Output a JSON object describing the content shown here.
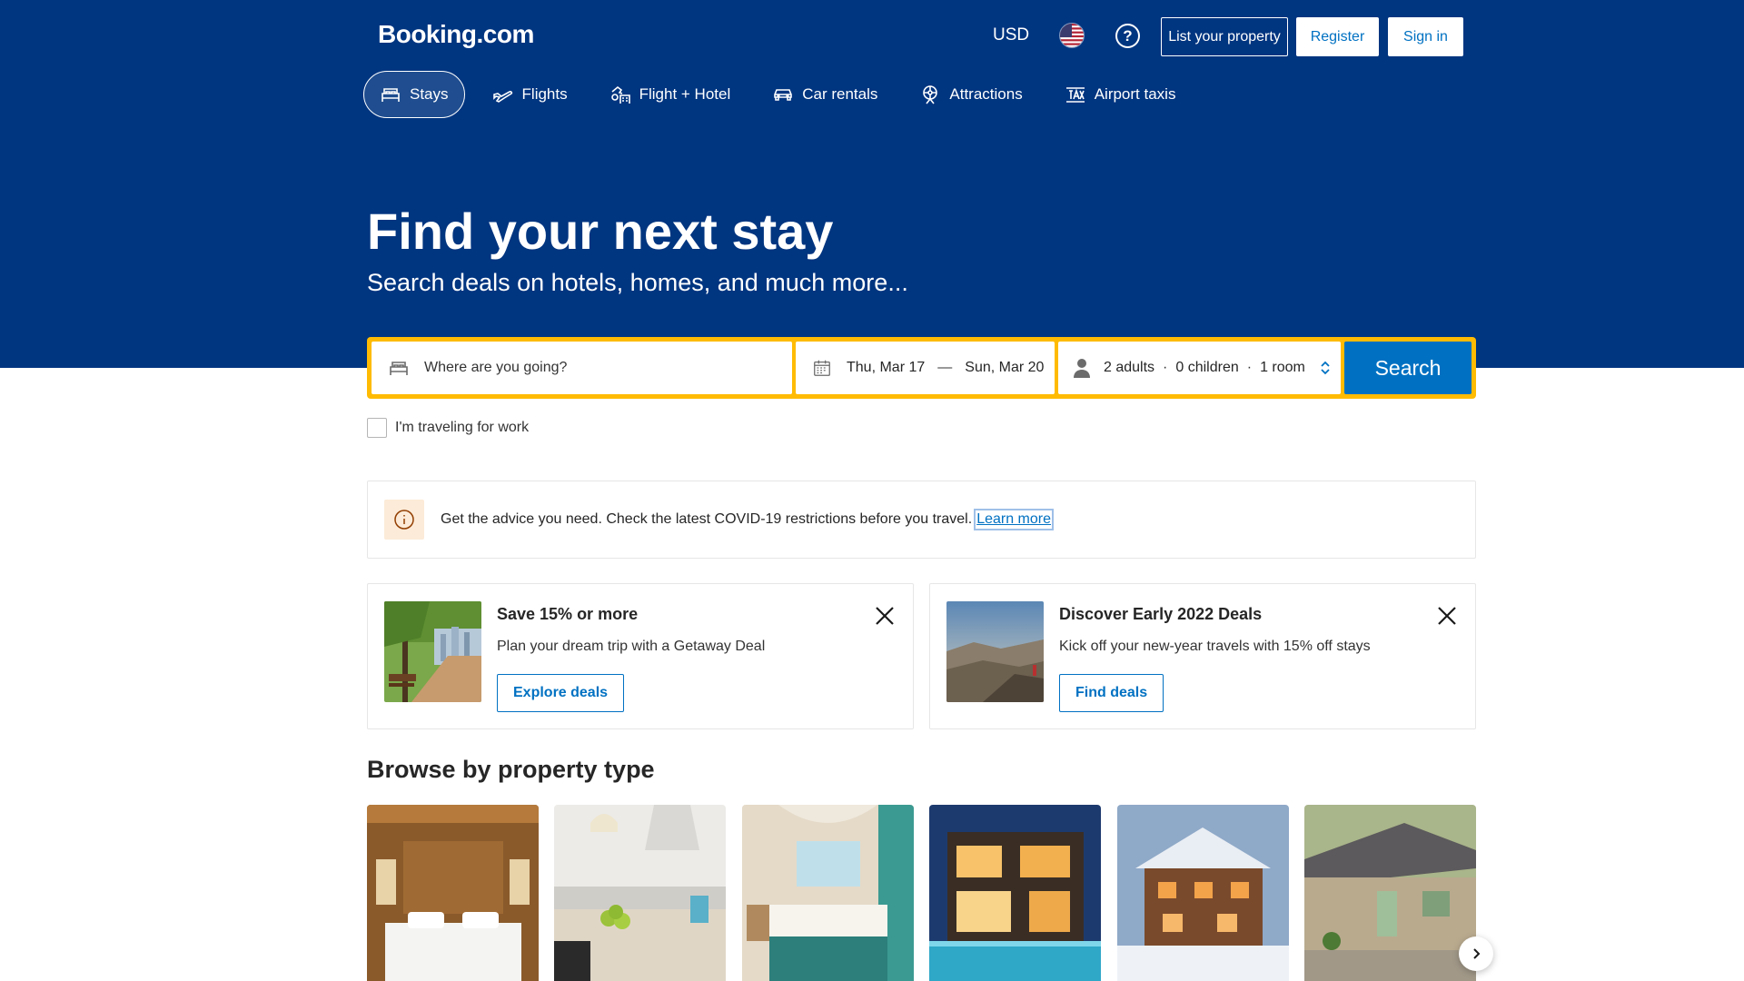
{
  "header": {
    "logo": "Booking.com",
    "currency": "USD",
    "help_icon": "help-circle-icon",
    "list_property": "List your property",
    "register": "Register",
    "sign_in": "Sign in"
  },
  "nav": {
    "items": [
      {
        "label": "Stays",
        "icon": "bed-icon",
        "active": true
      },
      {
        "label": "Flights",
        "icon": "plane-icon",
        "active": false
      },
      {
        "label": "Flight + Hotel",
        "icon": "flight-hotel-icon",
        "active": false
      },
      {
        "label": "Car rentals",
        "icon": "car-icon",
        "active": false
      },
      {
        "label": "Attractions",
        "icon": "attractions-icon",
        "active": false
      },
      {
        "label": "Airport taxis",
        "icon": "taxi-icon",
        "active": false
      }
    ]
  },
  "hero": {
    "title": "Find your next stay",
    "subtitle": "Search deals on hotels, homes, and much more..."
  },
  "search": {
    "destination_placeholder": "Where are you going?",
    "checkin": "Thu, Mar 17",
    "date_separator": "—",
    "checkout": "Sun, Mar 20",
    "adults": "2 adults",
    "children": "0 children",
    "rooms": "1 room",
    "separator": "·",
    "button": "Search"
  },
  "work_checkbox": {
    "label": "I'm traveling for work",
    "checked": false
  },
  "covid_banner": {
    "text": "Get the advice you need. Check the latest COVID-19 restrictions before you travel.",
    "link": "Learn more"
  },
  "promos": [
    {
      "title": "Save 15% or more",
      "description": "Plan your dream trip with a Getaway Deal",
      "button": "Explore deals"
    },
    {
      "title": "Discover Early 2022 Deals",
      "description": "Kick off your new-year travels with 15% off stays",
      "button": "Find deals"
    }
  ],
  "browse": {
    "title": "Browse by property type"
  },
  "colors": {
    "brand_blue": "#003580",
    "action_blue": "#0071c2",
    "search_yellow": "#febb02"
  }
}
